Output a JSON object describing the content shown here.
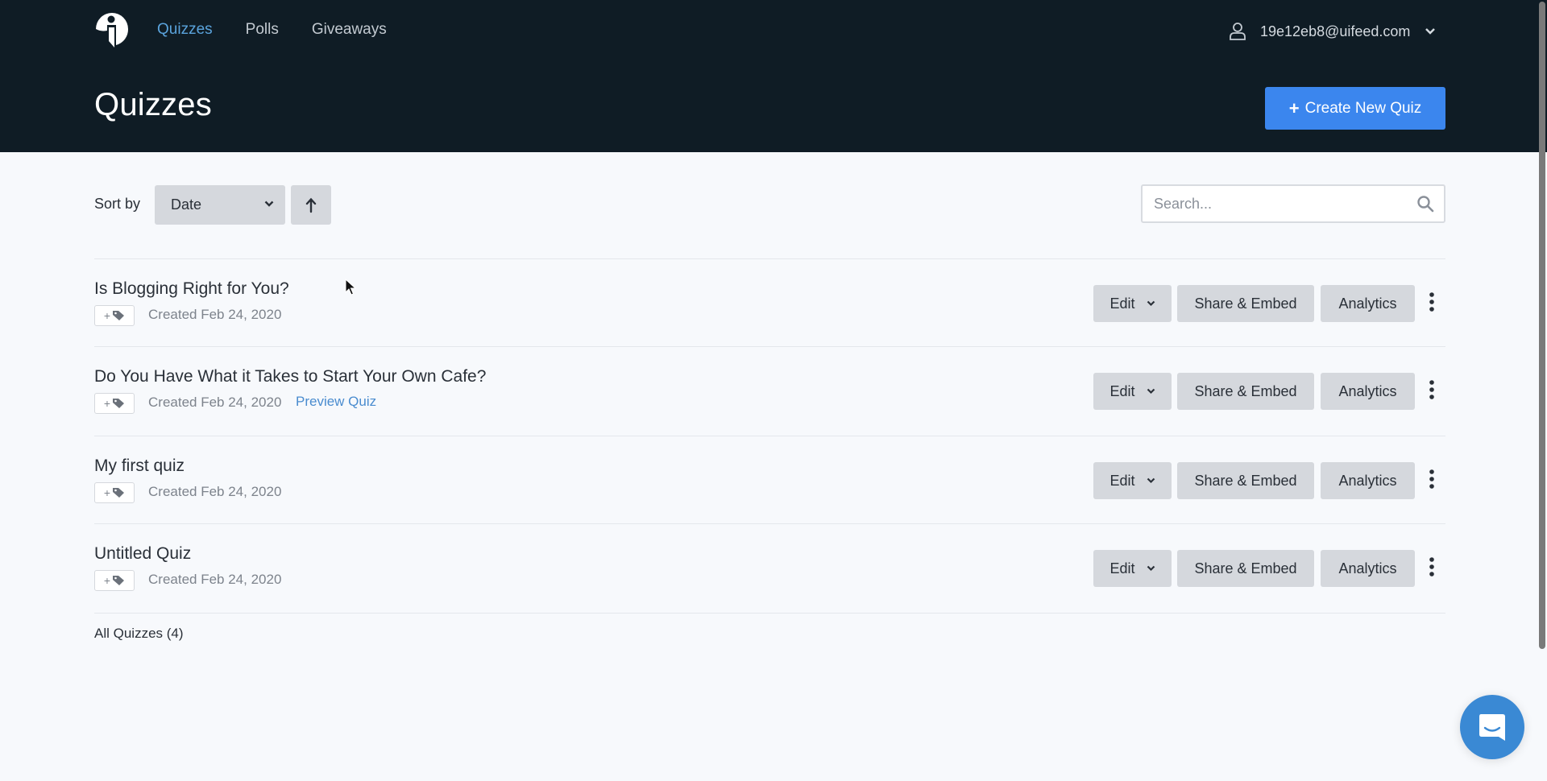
{
  "nav": {
    "logo_icon": "uifeed-logo-icon",
    "items": [
      {
        "label": "Quizzes",
        "active": true
      },
      {
        "label": "Polls",
        "active": false
      },
      {
        "label": "Giveaways",
        "active": false
      }
    ],
    "user": {
      "email": "19e12eb8@uifeed.com",
      "icon": "user-icon"
    }
  },
  "header": {
    "title": "Quizzes",
    "create_button": {
      "icon": "+",
      "label": "Create New Quiz"
    }
  },
  "toolbar": {
    "sort_label": "Sort by",
    "sort_value": "Date",
    "sort_direction_icon": "arrow-up-icon",
    "search_placeholder": "Search..."
  },
  "quizzes": [
    {
      "title": "Is Blogging Right for You?",
      "tag_label": "+",
      "created": "Created Feb 24, 2020",
      "preview": null
    },
    {
      "title": "Do You Have What it Takes to Start Your Own Cafe?",
      "tag_label": "+",
      "created": "Created Feb 24, 2020",
      "preview": "Preview Quiz"
    },
    {
      "title": "My first quiz",
      "tag_label": "+",
      "created": "Created Feb 24, 2020",
      "preview": null
    },
    {
      "title": "Untitled Quiz",
      "tag_label": "+",
      "created": "Created Feb 24, 2020",
      "preview": null
    }
  ],
  "actions": {
    "edit": "Edit",
    "share": "Share & Embed",
    "analytics": "Analytics"
  },
  "footer": {
    "all_count": "All Quizzes (4)"
  },
  "colors": {
    "header_bg": "#0f1c25",
    "accent": "#3b86ee",
    "nav_active": "#5aa3dc",
    "link": "#4a8ccf",
    "button_bg": "#d5d8dd",
    "chat_bg": "#3a89d4"
  }
}
